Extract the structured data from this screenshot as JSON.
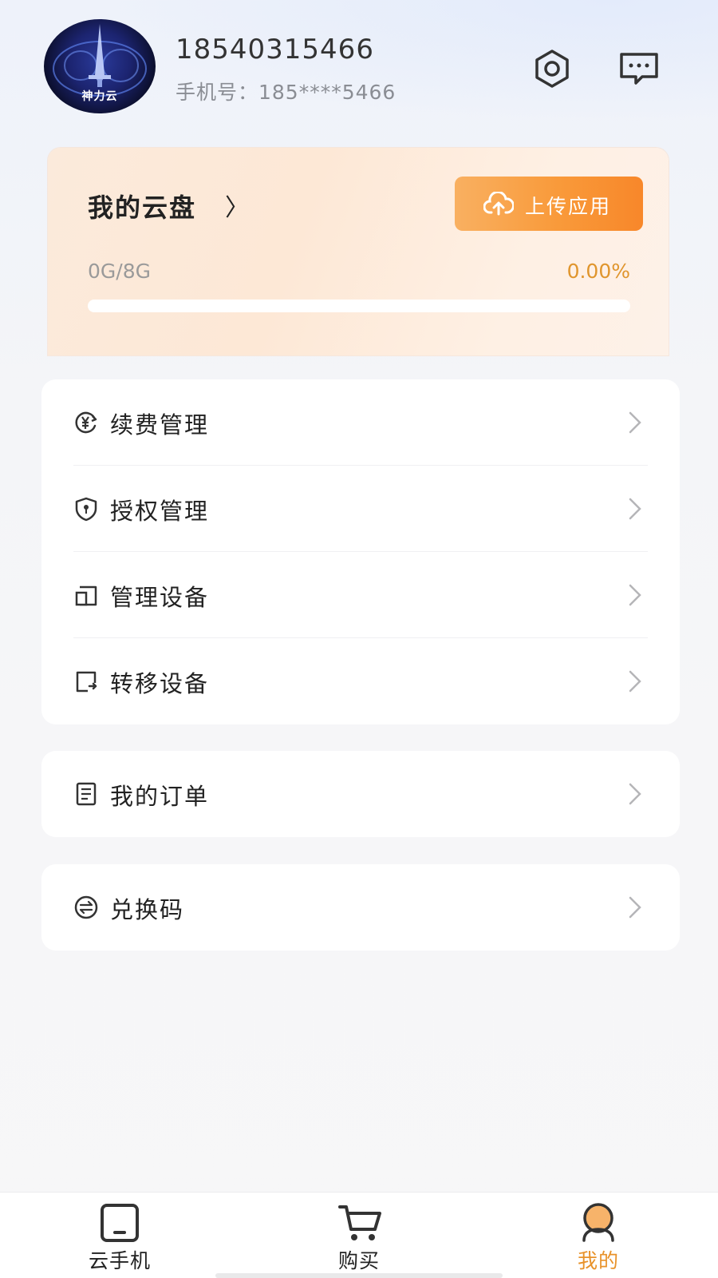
{
  "header": {
    "avatar_text": "神力云",
    "username": "18540315466",
    "phone": "手机号：185****5466",
    "icons": [
      "settings-icon",
      "message-icon"
    ]
  },
  "cloud_disk": {
    "title": "我的云盘",
    "chevron": "〉",
    "upload_label": "上传应用",
    "usage": "0G/8G",
    "percent": "0.00%",
    "progress_fraction": 0.0,
    "accent_color": "#f99a3a",
    "percent_color": "#e0952d"
  },
  "menu": {
    "group1": [
      {
        "label": "续费管理",
        "icon": "renew-yen-icon"
      },
      {
        "label": "授权管理",
        "icon": "shield-lock-icon"
      },
      {
        "label": "管理设备",
        "icon": "devices-icon"
      },
      {
        "label": "转移设备",
        "icon": "transfer-device-icon"
      }
    ],
    "group2": [
      {
        "label": "我的订单",
        "icon": "order-list-icon"
      }
    ],
    "group3": [
      {
        "label": "兑换码",
        "icon": "exchange-icon"
      }
    ]
  },
  "nav": {
    "tabs": [
      {
        "label": "云手机",
        "icon": "cloud-phone-icon",
        "active": false
      },
      {
        "label": "购买",
        "icon": "cart-icon",
        "active": false
      },
      {
        "label": "我的",
        "icon": "profile-icon",
        "active": true
      }
    ],
    "active_color": "#e8922a"
  }
}
